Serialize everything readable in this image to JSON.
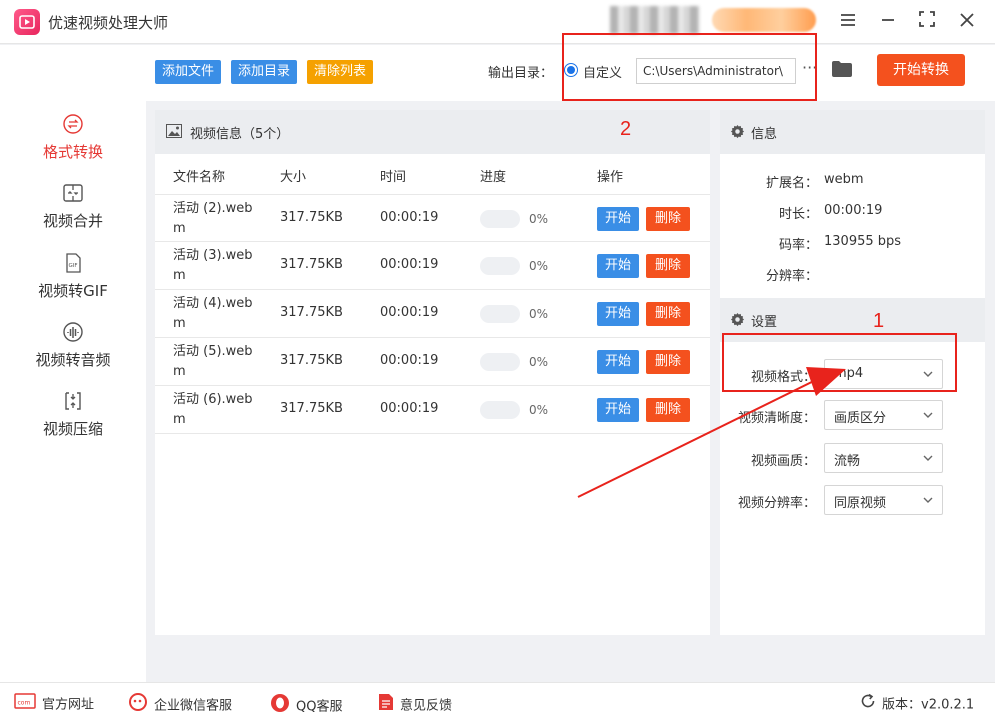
{
  "app": {
    "title": "优速视频处理大师",
    "icon": "play-logo-icon"
  },
  "window": {
    "menu_icon": "hamburger-icon",
    "min_icon": "minimize-icon",
    "max_icon": "fullscreen-icon",
    "close_icon": "close-icon"
  },
  "sidebar": {
    "items": [
      {
        "label": "格式转换",
        "icon": "format-convert-icon",
        "active": true
      },
      {
        "label": "视频合并",
        "icon": "merge-icon",
        "active": false
      },
      {
        "label": "视频转GIF",
        "icon": "gif-icon",
        "active": false
      },
      {
        "label": "视频转音频",
        "icon": "audio-icon",
        "active": false
      },
      {
        "label": "视频压缩",
        "icon": "compress-icon",
        "active": false
      }
    ]
  },
  "toolbar": {
    "add_file": "添加文件",
    "add_dir": "添加目录",
    "clear_list": "清除列表",
    "output_label": "输出目录：",
    "radio_label": "自定义",
    "path_value": "C:\\Users\\Administrator\\",
    "more": "···",
    "start_convert": "开始转换"
  },
  "files": {
    "header": "视频信息（5个）",
    "columns": {
      "name": "文件名称",
      "size": "大小",
      "time": "时间",
      "progress": "进度",
      "action": "操作"
    },
    "rows": [
      {
        "name": "活动 (2).webm",
        "size": "317.75KB",
        "time": "00:00:19",
        "progress": "0%",
        "start": "开始",
        "delete": "删除"
      },
      {
        "name": "活动 (3).webm",
        "size": "317.75KB",
        "time": "00:00:19",
        "progress": "0%",
        "start": "开始",
        "delete": "删除"
      },
      {
        "name": "活动 (4).webm",
        "size": "317.75KB",
        "time": "00:00:19",
        "progress": "0%",
        "start": "开始",
        "delete": "删除"
      },
      {
        "name": "活动 (5).webm",
        "size": "317.75KB",
        "time": "00:00:19",
        "progress": "0%",
        "start": "开始",
        "delete": "删除"
      },
      {
        "name": "活动 (6).webm",
        "size": "317.75KB",
        "time": "00:00:19",
        "progress": "0%",
        "start": "开始",
        "delete": "删除"
      }
    ]
  },
  "info": {
    "header": "信息",
    "ext_label": "扩展名：",
    "ext": "webm",
    "duration_label": "时长：",
    "duration": "00:00:19",
    "bitrate_label": "码率：",
    "bitrate": "130955 bps",
    "resolution_label": "分辨率：",
    "resolution": ""
  },
  "settings": {
    "header": "设置",
    "format_label": "视频格式：",
    "format": "mp4",
    "clarity_label": "视频清晰度：",
    "clarity": "画质区分",
    "quality_label": "视频画质：",
    "quality": "流畅",
    "resolution_label": "视频分辨率：",
    "resolution": "同原视频"
  },
  "annotations": {
    "one": "1",
    "two": "2",
    "color": "#e8231c"
  },
  "footer": {
    "website": "官方网址",
    "wechat": "企业微信客服",
    "qq": "QQ客服",
    "feedback": "意见反馈",
    "version": "版本：v2.0.2.1"
  }
}
